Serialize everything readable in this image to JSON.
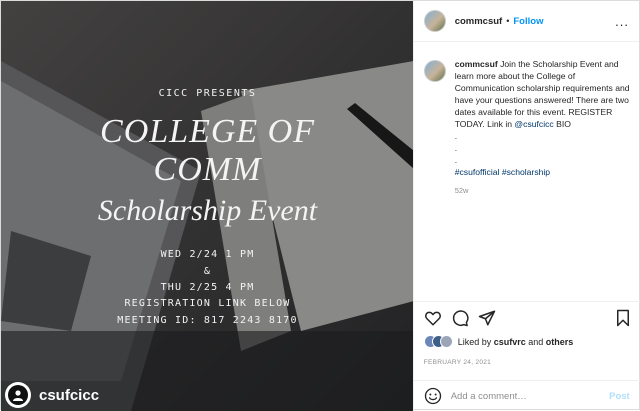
{
  "poster": {
    "presents": "CICC PRESENTS",
    "line1": "COLLEGE OF",
    "line2": "COMM",
    "line3": "Scholarship Event",
    "date1": "WED 2/24 1 PM",
    "amp": "&",
    "date2": "THU 2/25 4 PM",
    "registration": "REGISTRATION LINK BELOW",
    "meeting": "MEETING ID: 817 2243 8170"
  },
  "overlay_account": "csufcicc",
  "header": {
    "username": "commcsuf",
    "separator": "•",
    "follow": "Follow",
    "more": "..."
  },
  "caption": {
    "username": "commcsuf",
    "text": "Join the Scholarship Event and learn more about the College of Communication scholarship requirements and have your questions answered! There are two dates available for this event. REGISTER TODAY. Link in ",
    "mention": "@csufcicc",
    "after_mention": " BIO",
    "dots": [
      ".",
      ".",
      "."
    ],
    "hashtags": "#csufofficial #scholarship",
    "time": "52w"
  },
  "likes": {
    "prefix": "Liked by ",
    "user": "csufvrc",
    "middle": " and ",
    "others": "others"
  },
  "date": "FEBRUARY 24, 2021",
  "comment": {
    "placeholder": "Add a comment…",
    "post": "Post"
  },
  "icons": [
    "heart-icon",
    "comment-icon",
    "share-icon",
    "bookmark-icon",
    "emoji-icon"
  ]
}
